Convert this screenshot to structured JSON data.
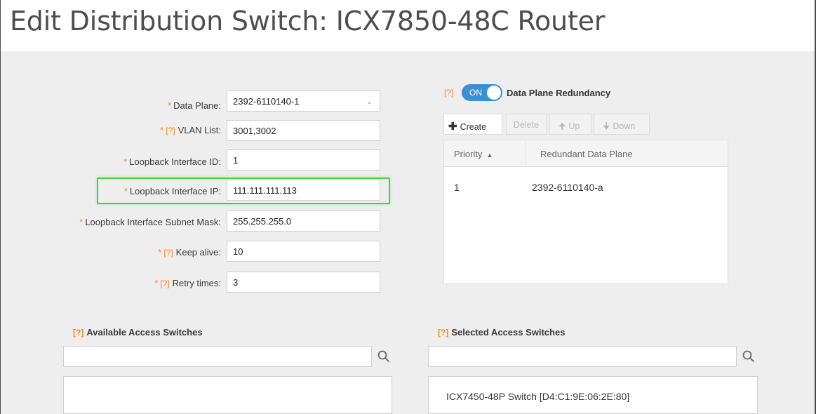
{
  "window": {
    "title": "Edit Distribution Switch: ICX7850-48C Router"
  },
  "form": {
    "required_mark": "*",
    "help_mark": "[?]",
    "data_plane": {
      "label": "Data Plane:",
      "value": "2392-6110140-1"
    },
    "vlan_list": {
      "label": "VLAN List:",
      "value": "3001,3002"
    },
    "loopback_id": {
      "label": "Loopback Interface ID:",
      "value": "1"
    },
    "loopback_ip": {
      "label": "Loopback Interface IP:",
      "value": "111.111.111.113"
    },
    "loopback_mask": {
      "label": "Loopback Interface Subnet Mask:",
      "value": "255.255.255.0"
    },
    "keep_alive": {
      "label": "Keep alive:",
      "value": "10"
    },
    "retry_times": {
      "label": "Retry times:",
      "value": "3"
    }
  },
  "redundancy": {
    "toggle_label": "ON",
    "toggle_on": true,
    "title": "Data Plane Redundancy",
    "toolbar": {
      "create": "Create",
      "delete": "Delete",
      "up": "Up",
      "down": "Down"
    },
    "columns": [
      "Priority",
      "Redundant Data Plane"
    ],
    "rows": [
      {
        "priority": "1",
        "plane": "2392-6110140-a"
      }
    ]
  },
  "available": {
    "title": "Available Access Switches",
    "search_value": "",
    "items": []
  },
  "selected": {
    "title": "Selected Access Switches",
    "search_value": "",
    "items": [
      "ICX7450-48P Switch [D4:C1:9E:06:2E:80]"
    ]
  },
  "colors": {
    "accent": "#3b8fd4",
    "required": "#f08a24",
    "highlight": "#47d147"
  }
}
